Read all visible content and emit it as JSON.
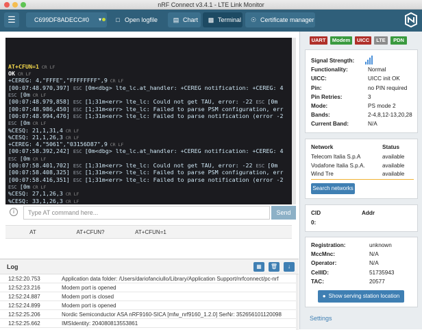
{
  "window": {
    "title": "nRF Connect v3.4.1 - LTE Link Monitor"
  },
  "nav": {
    "device": "C699DF8ADECC#0",
    "open_logfile": "Open logfile",
    "chart": "Chart",
    "terminal": "Terminal",
    "certificate_manager": "Certificate manager",
    "active_tab": "Terminal"
  },
  "terminal": {
    "lines": [
      {
        "text": "AT+CFUN=1",
        "cls": "yel",
        "crlf": true
      },
      {
        "text": "OK",
        "cls": "wht",
        "crlf": true
      },
      {
        "text": "+CEREG: 4,\"FFFE\",\"FFFFFFFF\",9",
        "crlf": true
      },
      {
        "text": "[00:07:48.970,397] ",
        "esc": true,
        "rest": "[0m<dbg> lte_lc.at_handler: +CEREG notification: +CEREG: 4"
      },
      {
        "text": "",
        "esc": true,
        "rest": "[0m",
        "crlf": true
      },
      {
        "text": "[00:07:48.979,858] ",
        "esc": true,
        "rest": "[1;31m<err> lte_lc: Could not get TAU, error: -22 ",
        "esc2": true,
        "rest2": "[0m"
      },
      {
        "text": "[00:07:48.986,450] ",
        "esc": true,
        "rest": "[1;31m<err> lte_lc: Failed to parse PSM configuration, err"
      },
      {
        "text": "[00:07:48.994,476] ",
        "esc": true,
        "rest": "[1;31m<err> lte_lc: Failed to parse notification (error -2"
      },
      {
        "text": "",
        "esc": true,
        "rest": "[0m",
        "crlf": true
      },
      {
        "text": "%CESQ: 21,1,31,4",
        "crlf": true
      },
      {
        "text": "%CESQ: 21,1,26,3",
        "crlf": true
      },
      {
        "text": "+CEREG: 4,\"5061\",\"03156D87\",9",
        "crlf": true
      },
      {
        "text": "[00:07:58.392,242] ",
        "esc": true,
        "rest": "[0m<dbg> lte_lc.at_handler: +CEREG notification: +CEREG: 4"
      },
      {
        "text": "",
        "esc": true,
        "rest": "[0m",
        "crlf": true
      },
      {
        "text": "[00:07:58.401,702] ",
        "esc": true,
        "rest": "[1;31m<err> lte_lc: Could not get TAU, error: -22 ",
        "esc2": true,
        "rest2": "[0m"
      },
      {
        "text": "[00:07:58.408,325] ",
        "esc": true,
        "rest": "[1;31m<err> lte_lc: Failed to parse PSM configuration, err"
      },
      {
        "text": "[00:07:58.416,351] ",
        "esc": true,
        "rest": "[1;31m<err> lte_lc: Failed to parse notification (error -2"
      },
      {
        "text": "",
        "esc": true,
        "rest": "[0m",
        "crlf": true
      },
      {
        "text": "%CESQ: 27,1,26,3",
        "crlf": true
      },
      {
        "text": "%CESQ: 33,1,26,3",
        "crlf": true
      }
    ],
    "esc_label": "ESC",
    "crlf_label": "CR LF",
    "input_placeholder": "Type AT command here...",
    "send": "Send",
    "macros": [
      "AT",
      "AT+CFUN?",
      "AT+CFUN=1"
    ]
  },
  "log": {
    "title": "Log",
    "rows": [
      {
        "time": "12:52:20.753",
        "msg": "Application data folder: /Users/dariofanciullo/Library/Application Support/nrfconnect/pc-nrf"
      },
      {
        "time": "12:52:23.216",
        "msg": "Modem port is opened"
      },
      {
        "time": "12:52:24.887",
        "msg": "Modem port is closed"
      },
      {
        "time": "12:52:24.899",
        "msg": "Modem port is opened"
      },
      {
        "time": "12:52:25.206",
        "msg": "Nordic Semiconductor ASA nRF9160-SICA [mfw_nrf9160_1.2.0] SerNr: 352656101120098"
      },
      {
        "time": "12:52:25.662",
        "msg": "IMSIdentity: 204080813553861"
      }
    ]
  },
  "status_badges": [
    {
      "label": "UART",
      "color": "#b0302a"
    },
    {
      "label": "Modem",
      "color": "#3a9a3f"
    },
    {
      "label": "UICC",
      "color": "#b0302a"
    },
    {
      "label": "LTE",
      "color": "#8c8c8c"
    },
    {
      "label": "PDN",
      "color": "#3a9a3f"
    }
  ],
  "modem_info": [
    {
      "key": "Signal Strength:",
      "value": ""
    },
    {
      "key": "Functionality:",
      "value": "Normal"
    },
    {
      "key": "UICC:",
      "value": "UICC init OK"
    },
    {
      "key": "Pin:",
      "value": "no PIN required"
    },
    {
      "key": "Pin Retries:",
      "value": "3"
    },
    {
      "key": "Mode:",
      "value": "PS mode 2"
    },
    {
      "key": "Bands:",
      "value": "2-4,8,12-13,20,28"
    },
    {
      "key": "Current Band:",
      "value": "N/A"
    }
  ],
  "networks": {
    "header_network": "Network",
    "header_status": "Status",
    "rows": [
      {
        "name": "Telecom Italia S.p.A",
        "status": "available"
      },
      {
        "name": "Vodafone Italia S.p.A.",
        "status": "available"
      },
      {
        "name": "Wind Tre",
        "status": "available"
      }
    ],
    "search_button": "Search networks"
  },
  "pdn": {
    "cid": "CID",
    "addr": "Addr",
    "cid_value": "0:"
  },
  "registration": [
    {
      "key": "Registration:",
      "value": "unknown"
    },
    {
      "key": "MccMnc:",
      "value": "N/A"
    },
    {
      "key": "Operator:",
      "value": "N/A"
    },
    {
      "key": "CellID:",
      "value": "51735943"
    },
    {
      "key": "TAC:",
      "value": "20577"
    }
  ],
  "serving_station_button": "Show serving station location",
  "settings_link": "Settings"
}
